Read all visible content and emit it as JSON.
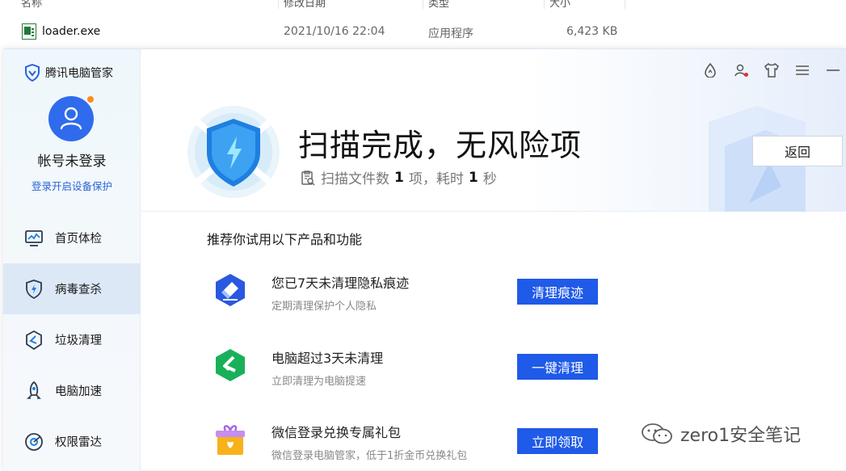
{
  "explorer": {
    "columns": [
      "名称",
      "修改日期",
      "类型",
      "大小"
    ],
    "file": {
      "name": "loader.exe",
      "modified": "2021/10/16 22:04",
      "type": "应用程序",
      "size": "6,423 KB"
    }
  },
  "app": {
    "brand": "腾讯电脑管家",
    "account": "帐号未登录",
    "login_link": "登录开启设备保护",
    "nav": [
      {
        "label": "首页体检",
        "icon": "monitor-icon"
      },
      {
        "label": "病毒查杀",
        "icon": "shield-bolt-icon",
        "active": true
      },
      {
        "label": "垃圾清理",
        "icon": "broom-icon"
      },
      {
        "label": "电脑加速",
        "icon": "rocket-icon"
      },
      {
        "label": "权限雷达",
        "icon": "radar-icon"
      }
    ],
    "title_icons": [
      "water-drop-icon",
      "user-alert-icon",
      "tshirt-skin-icon",
      "menu-icon",
      "minimize-icon"
    ],
    "headline": "扫描完成，无风险项",
    "scan": {
      "prefix": "扫描文件数",
      "files": "1",
      "unit": "项，耗时",
      "seconds": "1",
      "suffix": "秒"
    },
    "back_button": "返回",
    "recommend_title": "推荐你试用以下产品和功能",
    "recommendations": [
      {
        "title": "您已7天未清理隐私痕迹",
        "subtitle": "定期清理保护个人隐私",
        "button": "清理痕迹",
        "icon": "privacy-eraser-icon"
      },
      {
        "title": "电脑超过3天未清理",
        "subtitle": "立即清理为电脑提速",
        "button": "一键清理",
        "icon": "broom-clean-icon"
      },
      {
        "title": "微信登录兑换专属礼包",
        "subtitle": "微信登录电脑管家，低于1折金币兑换礼包",
        "button": "立即领取",
        "icon": "gift-box-icon"
      }
    ],
    "colors": {
      "accent": "#1f5ae8",
      "link": "#2a63d9",
      "avatar": "#2f6bec",
      "active_nav": "#dde8f7"
    }
  },
  "watermark": "zero1安全笔记"
}
